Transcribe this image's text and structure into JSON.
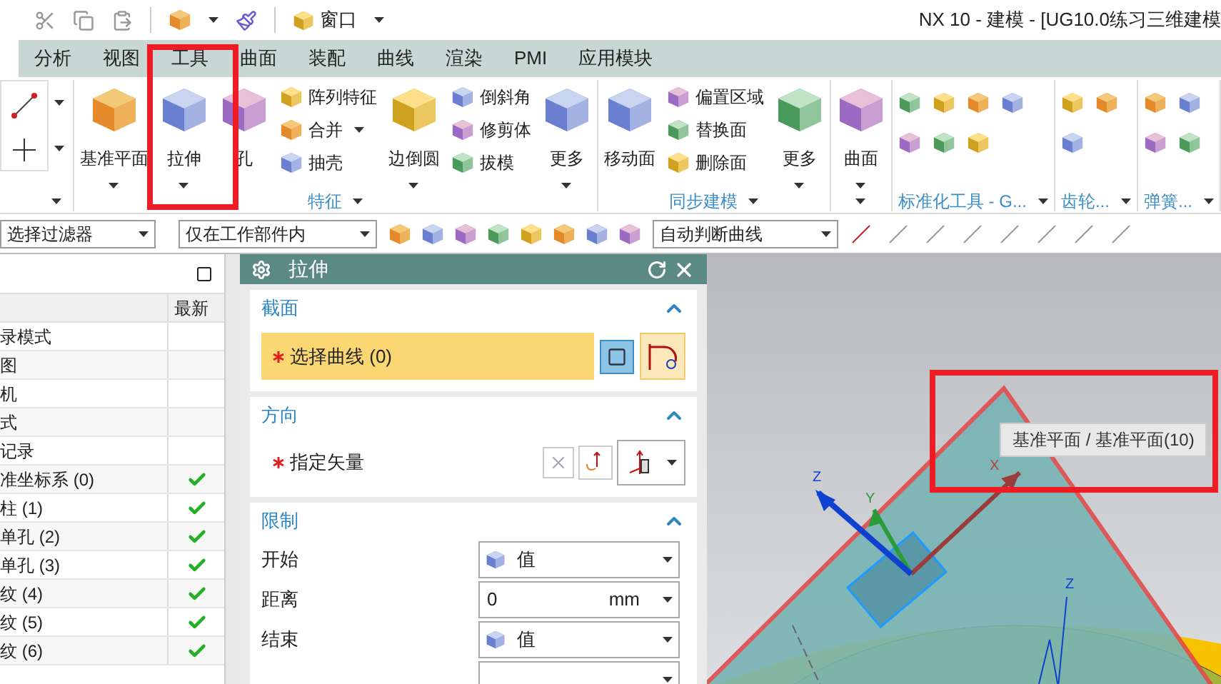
{
  "title_bar": {
    "title": "NX 10 - 建模 - [UG10.0练习三维建模",
    "menu": "窗口"
  },
  "tabs": [
    {
      "label": "分析",
      "selected": false
    },
    {
      "label": "视图",
      "selected": false
    },
    {
      "label": "工具",
      "selected": false
    },
    {
      "label": "曲面",
      "selected": false
    },
    {
      "label": "装配",
      "selected": false
    },
    {
      "label": "曲线",
      "selected": false
    },
    {
      "label": "渲染",
      "selected": false
    },
    {
      "label": "PMI",
      "selected": false
    },
    {
      "label": "应用模块",
      "selected": false
    }
  ],
  "ribbon_groups": [
    {
      "kind": "commands",
      "label": "特征",
      "items": [
        {
          "kind": "large",
          "label": "基准平面",
          "dropdown": true
        },
        {
          "kind": "large",
          "label": "拉伸",
          "dropdown": true
        },
        {
          "kind": "large",
          "label": "孔",
          "dropdown": false
        },
        {
          "kind": "stack",
          "items": [
            {
              "label": "阵列特征",
              "dropdown": false
            },
            {
              "label": "合并",
              "dropdown": true
            },
            {
              "label": "抽壳",
              "dropdown": false
            }
          ]
        },
        {
          "kind": "large",
          "label": "边倒圆",
          "dropdown": true
        },
        {
          "kind": "stack",
          "items": [
            {
              "label": "倒斜角",
              "dropdown": false
            },
            {
              "label": "修剪体",
              "dropdown": false
            },
            {
              "label": "拔模",
              "dropdown": false
            }
          ]
        },
        {
          "kind": "large",
          "label": "更多",
          "dropdown": true
        }
      ]
    },
    {
      "kind": "commands",
      "label": "同步建模",
      "items": [
        {
          "kind": "large",
          "label": "移动面",
          "dropdown": false
        },
        {
          "kind": "stack",
          "items": [
            {
              "label": "偏置区域",
              "dropdown": false
            },
            {
              "label": "替换面",
              "dropdown": false
            },
            {
              "label": "删除面",
              "dropdown": false
            }
          ]
        },
        {
          "kind": "large",
          "label": "更多",
          "dropdown": true
        }
      ]
    },
    {
      "kind": "commands",
      "items": [
        {
          "kind": "large",
          "label": "曲面",
          "dropdown": true
        }
      ]
    },
    {
      "kind": "icon_grid",
      "label": "标准化工具 - G..."
    },
    {
      "kind": "icon_grid",
      "label": "齿轮..."
    },
    {
      "kind": "icon_grid",
      "label": "弹簧..."
    }
  ],
  "selection_bar": {
    "filter": "选择过滤器",
    "scope": "仅在工作部件内",
    "curve_rule": "自动判断曲线"
  },
  "navigator": {
    "column_header": "最新",
    "rows": [
      {
        "name": "录模式",
        "latest": false
      },
      {
        "name": "图",
        "latest": false
      },
      {
        "name": "机",
        "latest": false
      },
      {
        "name": "式",
        "latest": false
      },
      {
        "name": "记录",
        "latest": false
      },
      {
        "name": "准坐标系 (0)",
        "latest": true
      },
      {
        "name": "柱 (1)",
        "latest": true
      },
      {
        "name": "单孔 (2)",
        "latest": true
      },
      {
        "name": "单孔 (3)",
        "latest": true
      },
      {
        "name": "纹 (4)",
        "latest": true
      },
      {
        "name": "纹 (5)",
        "latest": true
      },
      {
        "name": "纹 (6)",
        "latest": true
      }
    ]
  },
  "dialog": {
    "title": "拉伸",
    "sections": [
      {
        "title": "截面",
        "expanded": true,
        "rows": [
          {
            "kind": "select",
            "label": "选择曲线 (0)",
            "required": true,
            "active": true
          }
        ]
      },
      {
        "title": "方向",
        "expanded": true,
        "rows": [
          {
            "kind": "vector",
            "label": "指定矢量",
            "required": true,
            "active": false
          }
        ]
      },
      {
        "title": "限制",
        "expanded": true,
        "rows": [
          {
            "kind": "dropdown",
            "label": "开始",
            "value": "值"
          },
          {
            "kind": "number",
            "label": "距离",
            "value": "0",
            "unit": "mm"
          },
          {
            "kind": "dropdown",
            "label": "结束",
            "value": "值"
          },
          {
            "kind": "number"
          }
        ]
      }
    ]
  },
  "viewport": {
    "tooltip": "基准平面 / 基准平面(10)",
    "axes": [
      "X",
      "Y",
      "Z"
    ],
    "second_axis": "Z"
  }
}
